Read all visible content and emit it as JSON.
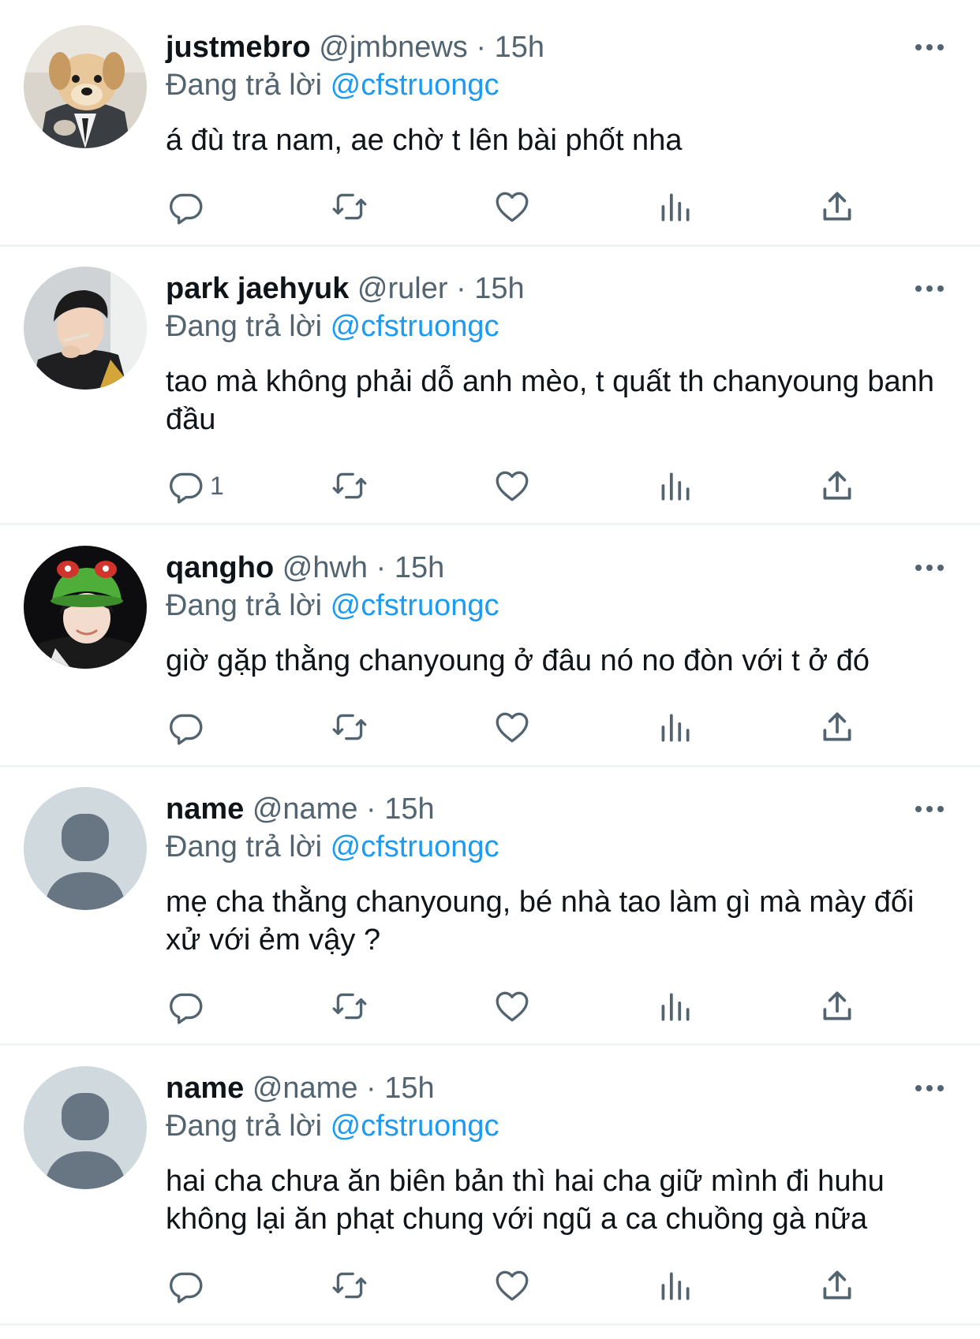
{
  "colors": {
    "accent": "#1d9bf0",
    "text": "#0f1419",
    "muted": "#536471",
    "divider": "#eff3f4"
  },
  "tweets": [
    {
      "name": "justmebro",
      "handle": "@jmbnews",
      "sep": "·",
      "time": "15h",
      "replying_prefix": "Đang trả lời",
      "replying_to": "@cfstruongc",
      "text": "á đù tra nam, ae chờ t lên bài phốt nha",
      "reply_count": "",
      "avatar": "dog-in-suit"
    },
    {
      "name": "park jaehyuk",
      "handle": "@ruler",
      "sep": "·",
      "time": "15h",
      "replying_prefix": "Đang trả lời",
      "replying_to": "@cfstruongc",
      "text": "tao mà không phải dỗ anh mèo, t quất th chanyoung banh đầu",
      "reply_count": "1",
      "avatar": "person-photo"
    },
    {
      "name": "qangho",
      "handle": "@hwh",
      "sep": "·",
      "time": "15h",
      "replying_prefix": "Đang trả lời",
      "replying_to": "@cfstruongc",
      "text": "giờ gặp thằng chanyoung ở đâu nó no đòn với t ở đó",
      "reply_count": "",
      "avatar": "person-with-hat"
    },
    {
      "name": "name",
      "handle": "@name",
      "sep": "·",
      "time": "15h",
      "replying_prefix": "Đang trả lời",
      "replying_to": "@cfstruongc",
      "text": "mẹ cha thằng chanyoung, bé nhà tao làm gì mà mày đối xử với ẻm vậy ?",
      "reply_count": "",
      "avatar": "default-avatar"
    },
    {
      "name": "name",
      "handle": "@name",
      "sep": "·",
      "time": "15h",
      "replying_prefix": "Đang trả lời",
      "replying_to": "@cfstruongc",
      "text": "hai cha chưa ăn biên bản thì hai cha giữ mình đi huhu không lại ăn phạt chung với ngũ a ca chuồng gà nữa",
      "reply_count": "",
      "avatar": "default-avatar"
    }
  ]
}
